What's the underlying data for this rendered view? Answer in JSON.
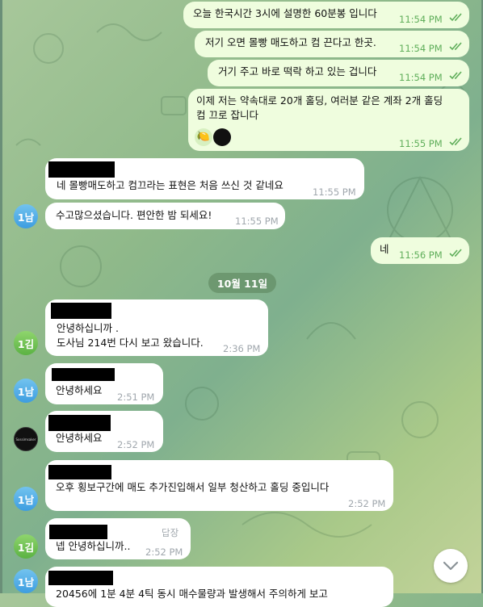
{
  "outgoing": [
    {
      "text": "오늘 한국시간 3시에 설명한 60분봉 입니다",
      "time": "11:54 PM"
    },
    {
      "text": "저기 오면 몰빵 매도하고 컴 끈다고 한곳.",
      "time": "11:54 PM"
    },
    {
      "text": "거기 주고 바로 떡락 하고 있는 겁니다",
      "time": "11:54 PM"
    },
    {
      "line1": "이제 저는 약속대로 20개 홀딩,  여러분 같은 계좌 2개 홀딩",
      "line2": "컴 끄로 잡니다",
      "time": "11:55 PM"
    },
    {
      "text": "네",
      "time": "11:56 PM"
    }
  ],
  "incoming": [
    {
      "text": "네 몰빵매도하고 컴끄라는 표현은 처음 쓰신 것 같네요",
      "time": "11:55 PM"
    },
    {
      "text": "수고많으셨습니다. 편안한 밤 되세요!",
      "time": "11:55 PM",
      "avatar": "1남"
    },
    {
      "line1": "안녕하십니까 .",
      "line2": "도사님  214번 다시 보고 왔습니다.",
      "time": "2:36 PM",
      "avatar": "1김"
    },
    {
      "text": "안녕하세요",
      "time": "2:51 PM",
      "avatar": "1남"
    },
    {
      "text": "안녕하세요",
      "time": "2:52 PM",
      "avatar_label": "Sossimsaker"
    },
    {
      "text": "오후 횡보구간에 매도 추가진입해서 일부 청산하고 홀딩 중입니다",
      "time": "2:52 PM",
      "avatar": "1남"
    },
    {
      "text": "넵 안녕하십니까..",
      "time": "2:52 PM",
      "avatar": "1김",
      "reply_label": "답장"
    },
    {
      "text": "20456에 1분 4분 4틱 동시 매수물량과 발생해서 주의하게 보고",
      "avatar": "1남"
    }
  ],
  "date_separator": "10월 11일",
  "colors": {
    "outgoing_bubble": "#effdde",
    "incoming_bubble": "#ffffff",
    "time_out": "#5fae5a",
    "time_in": "#a0a7ad"
  }
}
